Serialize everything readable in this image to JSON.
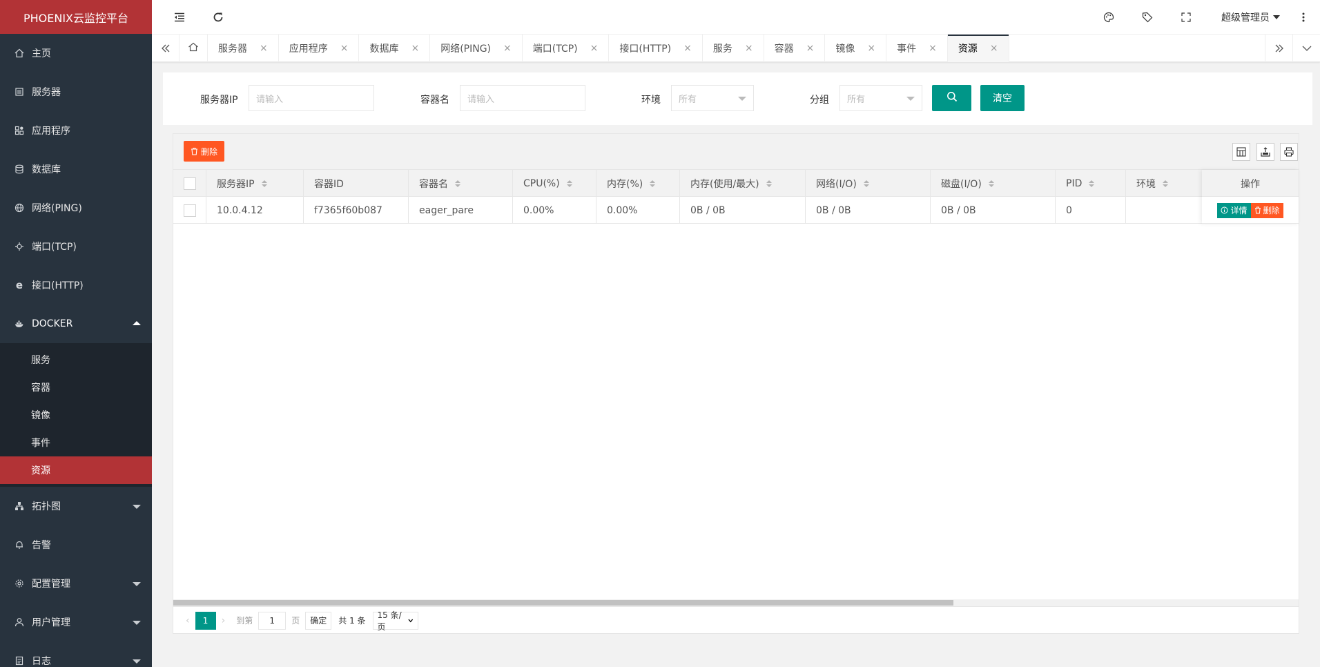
{
  "app": {
    "title": "PHOENIX云监控平台"
  },
  "sidebar": {
    "items": [
      {
        "label": "主页",
        "icon": "home-icon"
      },
      {
        "label": "服务器",
        "icon": "server-icon"
      },
      {
        "label": "应用程序",
        "icon": "app-icon"
      },
      {
        "label": "数据库",
        "icon": "database-icon"
      },
      {
        "label": "网络(PING)",
        "icon": "globe-icon"
      },
      {
        "label": "端口(TCP)",
        "icon": "port-icon"
      },
      {
        "label": "接口(HTTP)",
        "icon": "ie-icon"
      },
      {
        "label": "DOCKER",
        "icon": "docker-icon"
      }
    ],
    "docker_sub": [
      "服务",
      "容器",
      "镜像",
      "事件",
      "资源"
    ],
    "after": [
      {
        "label": "拓扑图",
        "icon": "topology-icon"
      },
      {
        "label": "告警",
        "icon": "bell-icon"
      },
      {
        "label": "配置管理",
        "icon": "gear-icon"
      },
      {
        "label": "用户管理",
        "icon": "user-icon"
      },
      {
        "label": "日志",
        "icon": "log-icon"
      }
    ]
  },
  "header": {
    "user": "超级管理员"
  },
  "tabs": [
    "服务器",
    "应用程序",
    "数据库",
    "网络(PING)",
    "端口(TCP)",
    "接口(HTTP)",
    "服务",
    "容器",
    "镜像",
    "事件",
    "资源"
  ],
  "search": {
    "server_ip_label": "服务器IP",
    "server_ip_placeholder": "请输入",
    "container_label": "容器名",
    "container_placeholder": "请输入",
    "env_label": "环境",
    "env_value": "所有",
    "group_label": "分组",
    "group_value": "所有",
    "clear_label": "清空"
  },
  "toolbar": {
    "delete_label": "删除"
  },
  "table": {
    "columns": [
      "服务器IP",
      "容器ID",
      "容器名",
      "CPU(%)",
      "内存(%)",
      "内存(使用/最大)",
      "网络(I/O)",
      "磁盘(I/O)",
      "PID",
      "环境"
    ],
    "op_header": "操作",
    "rows": [
      [
        "10.0.4.12",
        "f7365f60b087",
        "eager_pare",
        "0.00%",
        "0.00%",
        "0B / 0B",
        "0B / 0B",
        "0B / 0B",
        "0",
        ""
      ]
    ],
    "row_actions": {
      "detail": "详情",
      "delete": "删除"
    }
  },
  "pager": {
    "current": "1",
    "goto_label": "到第",
    "goto_value": "1",
    "page_unit": "页",
    "confirm": "确定",
    "total": "共 1 条",
    "page_size": "15 条/页"
  },
  "colors": {
    "brand": "#b23336",
    "sidebar": "#28333e",
    "primary": "#009688",
    "danger": "#ff5722"
  }
}
